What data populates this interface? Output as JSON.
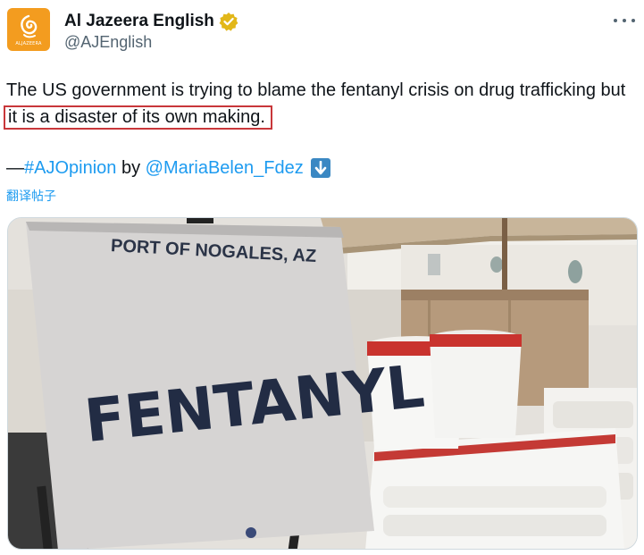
{
  "account": {
    "display_name": "Al Jazeera English",
    "handle": "@AJEnglish",
    "logo_text": "ALJAZEERA",
    "verified_color": "#e2b719",
    "brand_color": "#f39c1f"
  },
  "tweet": {
    "text_part1": "The US government is trying to blame the fentanyl crisis on drug trafficking but ",
    "text_highlight": "it is a disaster of its own making.",
    "credit_prefix": "— ",
    "hashtag": "#AJOpinion",
    "by_word": " by ",
    "author_mention": "@MariaBelen_Fdez",
    "arrow_icon": "down-arrow-emoji",
    "translate_label": "翻译帖子"
  },
  "media": {
    "sign_line1": "PORT OF NOGALES, AZ",
    "sign_word": "FENTANYL"
  }
}
